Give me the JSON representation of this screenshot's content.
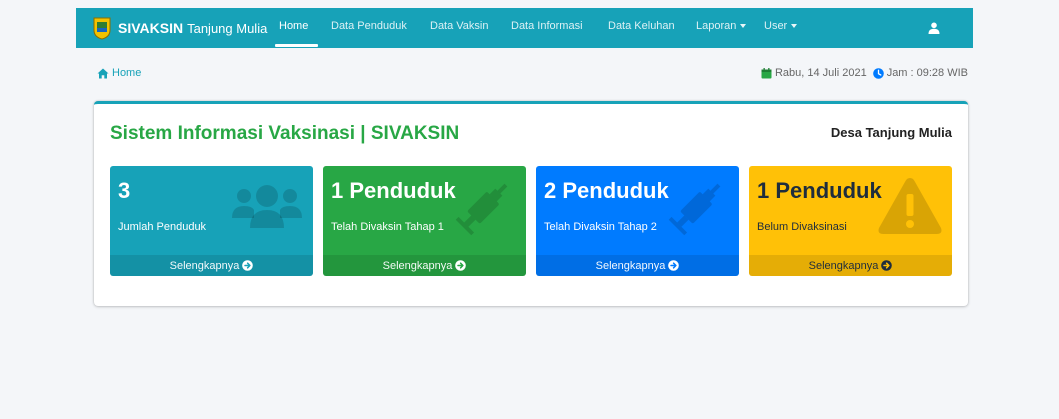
{
  "navbar": {
    "brand_bold": "SIVAKSIN",
    "brand_light": "Tanjung Mulia",
    "items": [
      {
        "label": "Home",
        "active": true
      },
      {
        "label": "Data Penduduk"
      },
      {
        "label": "Data Vaksin"
      },
      {
        "label": "Data Informasi"
      },
      {
        "label": "Data Keluhan"
      },
      {
        "label": "Laporan",
        "dropdown": true
      },
      {
        "label": "User",
        "dropdown": true
      }
    ],
    "user_icon": "user-icon"
  },
  "breadcrumb": {
    "icon": "home-icon",
    "label": "Home"
  },
  "datetime": {
    "date": "Rabu, 14 Juli 2021",
    "time": "Jam : 09:28 WIB"
  },
  "card": {
    "title": "Sistem Informasi Vaksinasi | SIVAKSIN",
    "subtitle": "Desa Tanjung Mulia"
  },
  "boxes": [
    {
      "value": "3",
      "label": "Jumlah Penduduk",
      "link": "Selengkapnya",
      "color": "#17a2b8",
      "icon": "users-icon"
    },
    {
      "value": "1 Penduduk",
      "label": "Telah Divaksin Tahap 1",
      "link": "Selengkapnya",
      "color": "#28a745",
      "icon": "syringe-icon"
    },
    {
      "value": "2 Penduduk",
      "label": "Telah Divaksin Tahap 2",
      "link": "Selengkapnya",
      "color": "#007bff",
      "icon": "syringe-icon"
    },
    {
      "value": "1 Penduduk",
      "label": "Belum Divaksinasi",
      "link": "Selengkapnya",
      "color": "#ffc107",
      "icon": "warning-icon"
    }
  ]
}
